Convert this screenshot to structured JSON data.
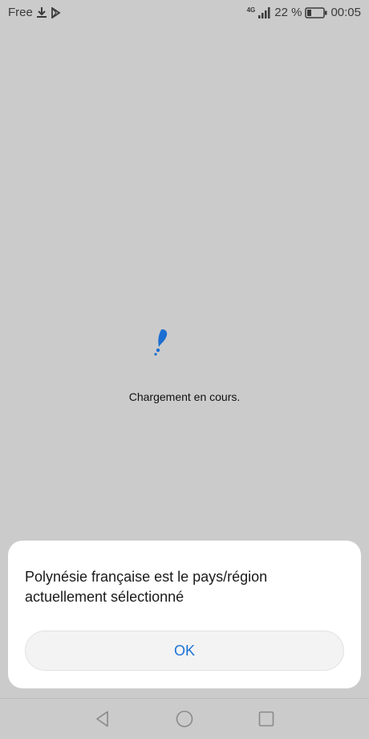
{
  "status_bar": {
    "carrier": "Free",
    "network_label": "4G",
    "battery_percent": "22 %",
    "time": "00:05",
    "icons": [
      "download-icon",
      "play-store-icon",
      "signal-icon",
      "battery-icon"
    ]
  },
  "loading": {
    "text": "Chargement en cours.",
    "icon": "loading-spinner-icon",
    "accent_color": "#1b6ed1"
  },
  "dialog": {
    "message": "Polynésie française est le pays/région actuellement sélectionné",
    "ok_label": "OK",
    "button_text_color": "#1b72d6"
  },
  "nav_bar": {
    "icons": [
      "back-icon",
      "home-icon",
      "recents-icon"
    ]
  }
}
